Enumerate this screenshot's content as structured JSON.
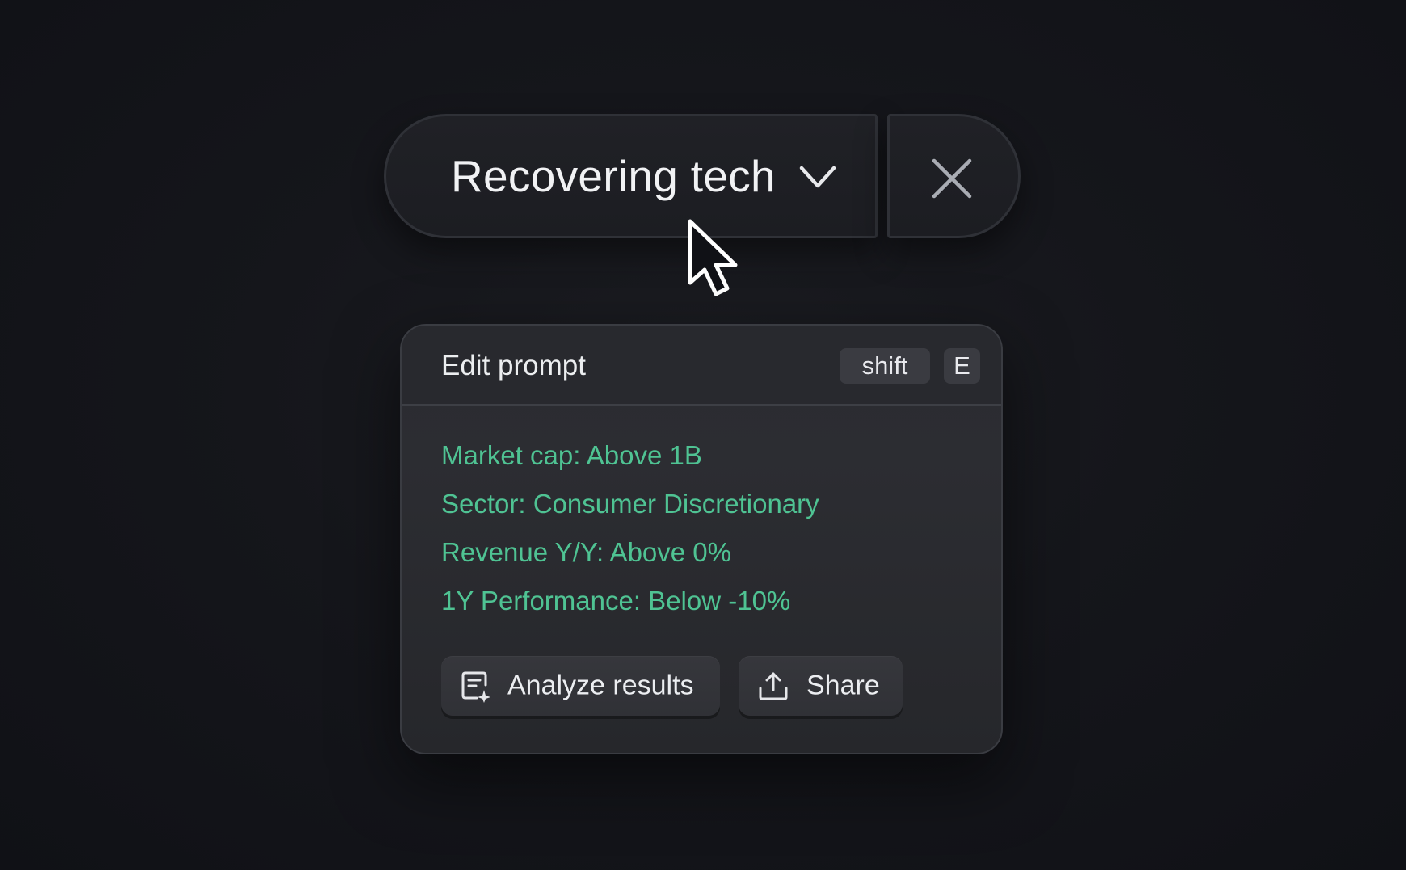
{
  "selector": {
    "title": "Recovering tech",
    "chevron_icon": "chevron-down-icon",
    "close_icon": "close-icon"
  },
  "card": {
    "title": "Edit prompt",
    "shortcut": {
      "modifier": "shift",
      "key": "E"
    },
    "criteria": [
      "Market cap: Above 1B",
      "Sector: Consumer Discretionary",
      "Revenue Y/Y: Above 0%",
      "1Y Performance: Below -10%"
    ],
    "buttons": {
      "analyze_label": "Analyze results",
      "analyze_icon": "analyze-sparkle-icon",
      "share_label": "Share",
      "share_icon": "share-upload-icon"
    }
  },
  "colors": {
    "background": "#15161b",
    "criteria_text": "#4fc393",
    "primary_text": "#f1f2f4"
  }
}
